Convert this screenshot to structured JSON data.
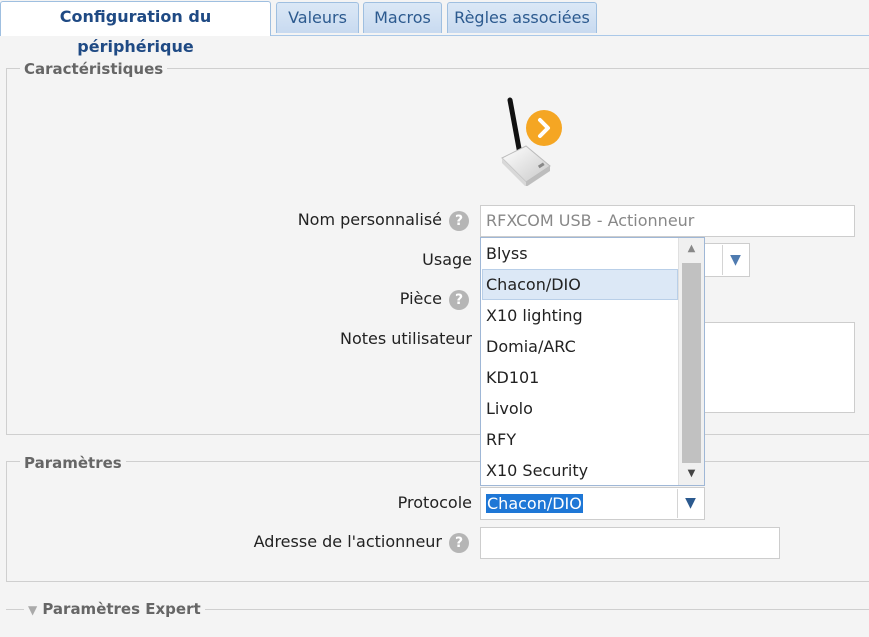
{
  "tabs": [
    {
      "label": "Configuration du périphérique",
      "active": true
    },
    {
      "label": "Valeurs"
    },
    {
      "label": "Macros"
    },
    {
      "label": "Règles associées"
    }
  ],
  "characteristics": {
    "legend": "Caractéristiques",
    "device_icon": "rfxcom-usb-antenna-icon",
    "name_label": "Nom personnalisé",
    "name_placeholder": "RFXCOM USB - Actionneur",
    "usage_label": "Usage",
    "room_label": "Pièce",
    "notes_label": "Notes utilisateur",
    "help_glyph": "?"
  },
  "protocol_dropdown": {
    "options": [
      "Blyss",
      "Chacon/DIO",
      "X10 lighting",
      "Domia/ARC",
      "KD101",
      "Livolo",
      "RFY",
      "X10 Security"
    ],
    "highlighted": "Chacon/DIO"
  },
  "parameters": {
    "legend": "Paramètres",
    "protocol_label": "Protocole",
    "protocol_value": "Chacon/DIO",
    "address_label": "Adresse de l'actionneur"
  },
  "expert": {
    "legend": "Paramètres Expert"
  },
  "colors": {
    "active_tab_text": "#1f4a84",
    "selection_bg": "#1e77d6",
    "help_bg": "#b5b5b5",
    "icon_badge": "#f5a623"
  }
}
